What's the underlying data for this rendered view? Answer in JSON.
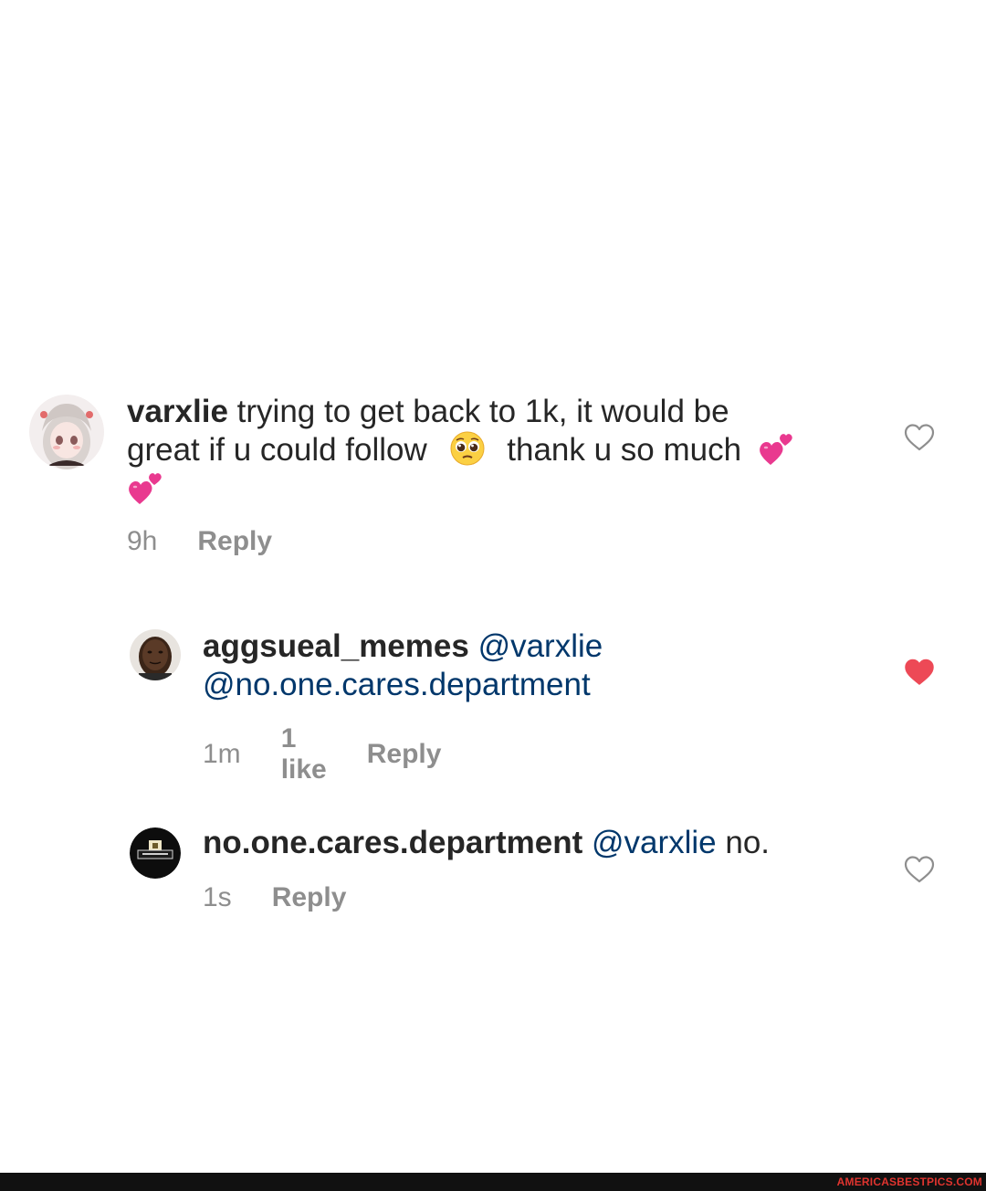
{
  "comments": [
    {
      "username": "varxlie",
      "text_line1": "trying to get back to 1k, it would be",
      "text_line2a": "great if u could follow",
      "text_line2b": "thank u so much",
      "emoji_pleading": "pleading-face-emoji",
      "emoji_hearts": "two-hearts-emoji",
      "time": "9h",
      "reply_label": "Reply",
      "liked": false
    },
    {
      "username": "aggsueal_memes",
      "mention1": "@varxlie",
      "mention2": "@no.one.cares.department",
      "time": "1m",
      "likes": "1 like",
      "reply_label": "Reply",
      "liked": true
    },
    {
      "username": "no.one.cares.department",
      "mention1": "@varxlie",
      "text": "no.",
      "time": "1s",
      "reply_label": "Reply",
      "liked": false
    }
  ],
  "colors": {
    "text": "#262626",
    "mention": "#00376b",
    "meta": "#8e8e8e",
    "liked_heart": "#ed4956"
  },
  "footer": {
    "watermark": "AMERICASBESTPICS.COM"
  }
}
